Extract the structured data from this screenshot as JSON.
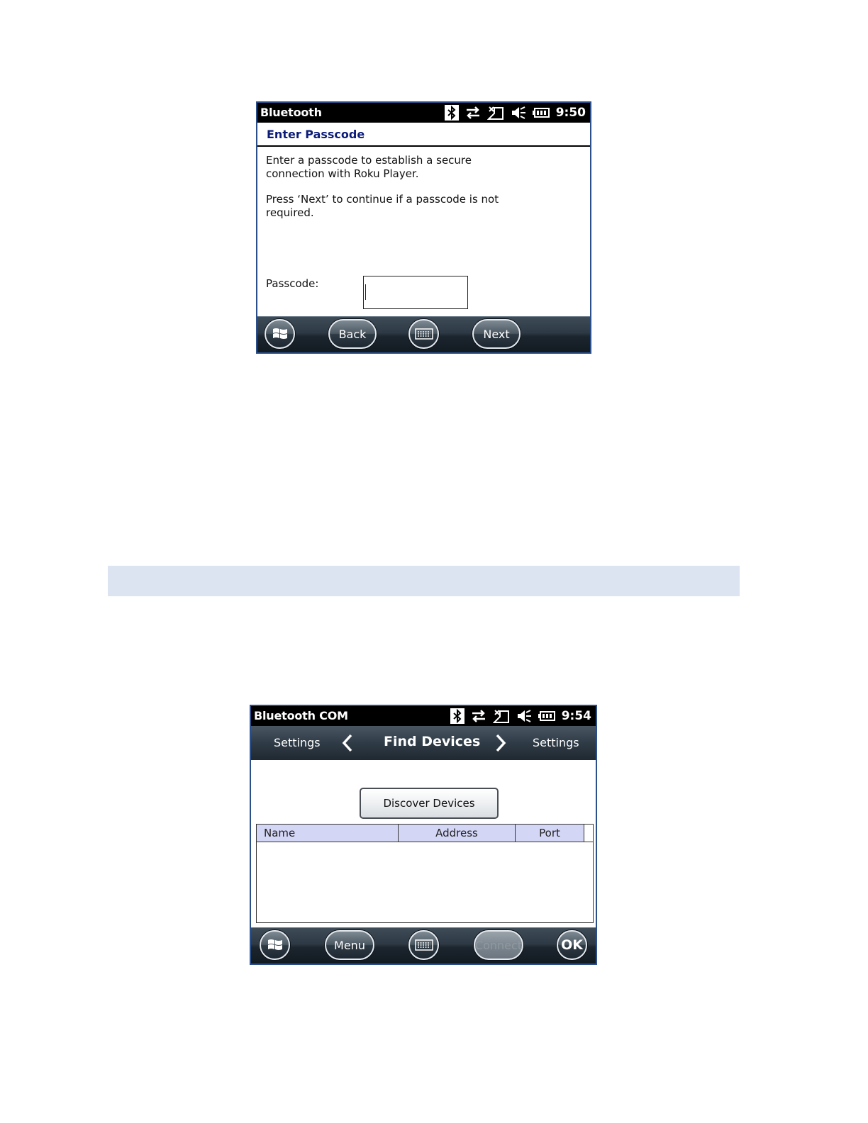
{
  "screen1": {
    "status": {
      "title": "Bluetooth",
      "time": "9:50"
    },
    "header": "Enter Passcode",
    "message1_line1": "Enter a passcode to establish a secure",
    "message1_line2": "connection with Roku Player.",
    "message2_line1": "Press ‘Next’ to continue if a passcode is not",
    "message2_line2": "required.",
    "passcode_label": "Passcode:",
    "passcode_value": "",
    "buttons": {
      "back": "Back",
      "next": "Next"
    }
  },
  "screen2": {
    "status": {
      "title": "Bluetooth COM",
      "time": "9:54"
    },
    "nav": {
      "prev": "Settings",
      "title": "Find Devices",
      "next": "Settings"
    },
    "discover_button": "Discover Devices",
    "table": {
      "columns": [
        "Name",
        "Address",
        "Port"
      ],
      "rows": []
    },
    "buttons": {
      "menu": "Menu",
      "connect": "Connect",
      "ok": "OK"
    }
  },
  "colors": {
    "header_text": "#0c1c78",
    "table_header_bg": "#d4d6f5",
    "band": "#dce4f1"
  },
  "icons": [
    "bluetooth-icon",
    "sync-arrows-icon",
    "no-signal-icon",
    "volume-muted-icon",
    "battery-icon",
    "windows-start-icon",
    "keyboard-icon",
    "chevron-left-icon",
    "chevron-right-icon"
  ]
}
